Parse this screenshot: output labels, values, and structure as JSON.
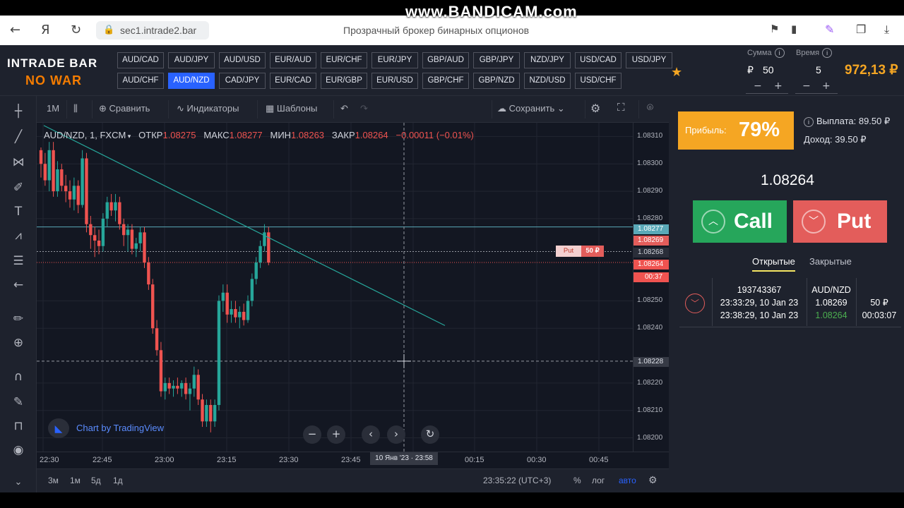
{
  "browser": {
    "url": "sec1.intrade2.bar",
    "page_title": "Прозрачный брокер бинарных опционов",
    "watermark": "www.BANDICAM.com"
  },
  "header": {
    "logo_line1": "INTRADE BAR",
    "logo_line2": "NO WAR",
    "pairs_row1": [
      "AUD/CAD",
      "AUD/JPY",
      "AUD/USD",
      "EUR/AUD",
      "EUR/CHF",
      "EUR/JPY",
      "GBP/AUD",
      "GBP/JPY",
      "NZD/JPY",
      "USD/CAD",
      "USD/JPY"
    ],
    "pairs_row2": [
      "AUD/CHF",
      "AUD/NZD",
      "CAD/JPY",
      "EUR/CAD",
      "EUR/GBP",
      "EUR/USD",
      "GBP/CHF",
      "GBP/NZD",
      "NZD/USD",
      "USD/CHF"
    ],
    "active_pair": "AUD/NZD",
    "sum_label": "Сумма",
    "time_label": "Время",
    "currency": "₽",
    "sum_value": "50",
    "time_value": "5",
    "balance": "972,13 ₽"
  },
  "toolbar": {
    "interval": "1M",
    "compare": "Сравнить",
    "indicators": "Индикаторы",
    "templates": "Шаблоны",
    "save": "Сохранить"
  },
  "chart": {
    "symbol": "AUD/NZD, 1, FXCM",
    "open_label": "ОТКР",
    "open_value": "1.08275",
    "high_label": "МАКС",
    "high_value": "1.08277",
    "low_label": "МИН",
    "low_value": "1.08263",
    "close_label": "ЗАКР",
    "close_value": "1.08264",
    "change": "−0.00011 (−0.01%)",
    "price_levels": [
      "1.08310",
      "1.08300",
      "1.08290",
      "1.08280",
      "1.08250",
      "1.08240",
      "1.08220",
      "1.08210",
      "1.08200"
    ],
    "tag_high": "1.08277",
    "tag_entry": "1.08269",
    "tag_cross": "1.08268",
    "tag_last": "1.08264",
    "tag_timer": "00:37",
    "tag_cursor": "1.08228",
    "deal_tag_label": "Put",
    "deal_tag_amount": "50 ₽",
    "time_labels": [
      "22:30",
      "22:45",
      "23:00",
      "23:15",
      "23:30",
      "23:45",
      "00:15",
      "00:30",
      "00:45"
    ],
    "cursor_time": "10 Янв '23 · 23:58",
    "attribution": "Chart by TradingView",
    "clock": "23:35:22 (UTC+3)",
    "ranges": [
      "3м",
      "1м",
      "5д",
      "1д"
    ],
    "percent": "%",
    "log": "лог",
    "auto": "авто"
  },
  "chart_data": {
    "type": "candlestick",
    "title": "AUD/NZD, 1, FXCM",
    "ylim": [
      1.08195,
      1.08315
    ],
    "candles": [
      [
        1.08305,
        1.08306,
        1.08295,
        1.083
      ],
      [
        1.083,
        1.08304,
        1.08292,
        1.08294
      ],
      [
        1.08294,
        1.08308,
        1.0829,
        1.08305
      ],
      [
        1.08305,
        1.08308,
        1.08288,
        1.0829
      ],
      [
        1.0829,
        1.08301,
        1.08288,
        1.08298
      ],
      [
        1.08298,
        1.083,
        1.0829,
        1.08292
      ],
      [
        1.08292,
        1.08296,
        1.08286,
        1.0829
      ],
      [
        1.0829,
        1.08294,
        1.08284,
        1.08287
      ],
      [
        1.08287,
        1.08295,
        1.08283,
        1.08292
      ],
      [
        1.08292,
        1.08294,
        1.08282,
        1.08285
      ],
      [
        1.08285,
        1.08305,
        1.08284,
        1.08302
      ],
      [
        1.08302,
        1.08304,
        1.08275,
        1.08278
      ],
      [
        1.08278,
        1.08281,
        1.08269,
        1.08274
      ],
      [
        1.08274,
        1.08277,
        1.08266,
        1.08272
      ],
      [
        1.08272,
        1.08276,
        1.08267,
        1.0827
      ],
      [
        1.0827,
        1.08282,
        1.08268,
        1.0828
      ],
      [
        1.0828,
        1.08288,
        1.08277,
        1.08286
      ],
      [
        1.08286,
        1.08289,
        1.08281,
        1.08283
      ],
      [
        1.08283,
        1.08289,
        1.08279,
        1.08286
      ],
      [
        1.08286,
        1.08288,
        1.08276,
        1.08278
      ],
      [
        1.08278,
        1.0828,
        1.0827,
        1.08274
      ],
      [
        1.08274,
        1.08278,
        1.08268,
        1.08276
      ],
      [
        1.08276,
        1.08278,
        1.08267,
        1.08269
      ],
      [
        1.08269,
        1.08273,
        1.08266,
        1.08271
      ],
      [
        1.08271,
        1.08277,
        1.08268,
        1.08275
      ],
      [
        1.08275,
        1.08277,
        1.08262,
        1.08264
      ],
      [
        1.08264,
        1.08266,
        1.08254,
        1.08256
      ],
      [
        1.08256,
        1.08258,
        1.08238,
        1.0824
      ],
      [
        1.0824,
        1.08243,
        1.0823,
        1.08232
      ],
      [
        1.08232,
        1.08235,
        1.08215,
        1.08217
      ],
      [
        1.08217,
        1.08222,
        1.08214,
        1.0822
      ],
      [
        1.0822,
        1.08222,
        1.08216,
        1.08218
      ],
      [
        1.08218,
        1.08221,
        1.08215,
        1.08219
      ],
      [
        1.08219,
        1.08222,
        1.08216,
        1.08218
      ],
      [
        1.08218,
        1.08221,
        1.08215,
        1.0822
      ],
      [
        1.0822,
        1.08222,
        1.08214,
        1.08216
      ],
      [
        1.08216,
        1.0822,
        1.0821,
        1.08218
      ],
      [
        1.08218,
        1.08226,
        1.08215,
        1.08223
      ],
      [
        1.08223,
        1.08225,
        1.08212,
        1.08214
      ],
      [
        1.08214,
        1.08216,
        1.08204,
        1.08206
      ],
      [
        1.08206,
        1.08214,
        1.08204,
        1.08212
      ],
      [
        1.08212,
        1.08214,
        1.08202,
        1.08206
      ],
      [
        1.08206,
        1.08214,
        1.08204,
        1.08212
      ],
      [
        1.08212,
        1.08252,
        1.0821,
        1.0825
      ],
      [
        1.0825,
        1.08256,
        1.08246,
        1.08253
      ],
      [
        1.08253,
        1.08256,
        1.08242,
        1.08245
      ],
      [
        1.08245,
        1.0825,
        1.08242,
        1.08247
      ],
      [
        1.08247,
        1.0825,
        1.08242,
        1.08244
      ],
      [
        1.08244,
        1.08248,
        1.0824,
        1.08246
      ],
      [
        1.08246,
        1.08249,
        1.08241,
        1.08243
      ],
      [
        1.08243,
        1.08252,
        1.08242,
        1.0825
      ],
      [
        1.0825,
        1.0826,
        1.08248,
        1.08258
      ],
      [
        1.08258,
        1.08266,
        1.08256,
        1.08264
      ],
      [
        1.08264,
        1.08272,
        1.08262,
        1.0827
      ],
      [
        1.0827,
        1.08278,
        1.08268,
        1.08275
      ],
      [
        1.08275,
        1.08277,
        1.08263,
        1.08264
      ]
    ],
    "horizontal_lines": [
      1.08277,
      1.08268,
      1.08264,
      1.08228
    ],
    "trendline": {
      "from": [
        "22:30",
        1.08314
      ],
      "to": [
        "23:50",
        1.08241
      ]
    }
  },
  "panel": {
    "profit_label": "Прибыль:",
    "profit_value": "79%",
    "payout": "Выплата: 89.50 ₽",
    "income": "Доход: 39.50 ₽",
    "current_price": "1.08264",
    "call_label": "Call",
    "put_label": "Put",
    "tab_open": "Открытые",
    "tab_closed": "Закрытые",
    "trade": {
      "id": "193743367",
      "open_time": "23:33:29, 10 Jan 23",
      "close_time": "23:38:29, 10 Jan 23",
      "pair": "AUD/NZD",
      "open_price": "1.08269",
      "current_price": "1.08264",
      "amount": "50 ₽",
      "remaining": "00:03:07"
    }
  },
  "colors": {
    "up": "#26a69a",
    "down": "#ef5350",
    "accent_orange": "#f5a623",
    "call_green": "#26a65b",
    "put_red": "#e35d5b"
  }
}
